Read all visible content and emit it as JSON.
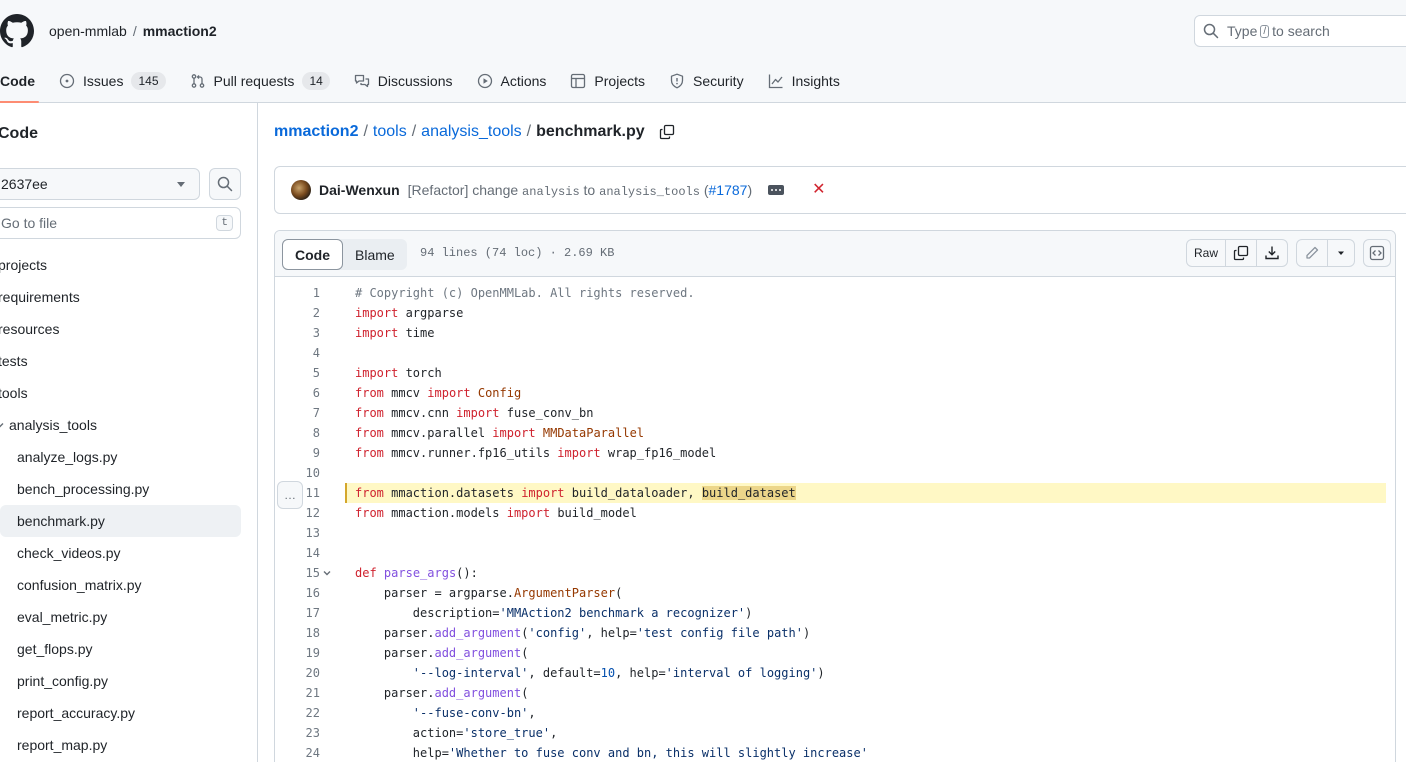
{
  "header": {
    "owner": "open-mmlab",
    "separator": "/",
    "repo": "mmaction2",
    "search_prefix": "Type",
    "search_key": "/",
    "search_suffix": "to search"
  },
  "tabs": [
    {
      "label": "Code",
      "icon": "code-icon",
      "selected": true
    },
    {
      "label": "Issues",
      "icon": "issue-opened-icon",
      "count": "145"
    },
    {
      "label": "Pull requests",
      "icon": "git-pull-request-icon",
      "count": "14"
    },
    {
      "label": "Discussions",
      "icon": "comment-discussion-icon"
    },
    {
      "label": "Actions",
      "icon": "play-icon"
    },
    {
      "label": "Projects",
      "icon": "table-icon"
    },
    {
      "label": "Security",
      "icon": "shield-icon"
    },
    {
      "label": "Insights",
      "icon": "graph-icon"
    }
  ],
  "sidebar": {
    "title": "Code",
    "branch": "2637ee",
    "goto_placeholder": "Go to file",
    "goto_shortcut": "t",
    "tree": [
      {
        "label": "projects",
        "depth": 0
      },
      {
        "label": "requirements",
        "depth": 0
      },
      {
        "label": "resources",
        "depth": 0
      },
      {
        "label": "tests",
        "depth": 0
      },
      {
        "label": "tools",
        "depth": 0
      },
      {
        "label": "analysis_tools",
        "depth": 1
      },
      {
        "label": "analyze_logs.py",
        "depth": 2
      },
      {
        "label": "bench_processing.py",
        "depth": 2
      },
      {
        "label": "benchmark.py",
        "depth": 2,
        "active": true
      },
      {
        "label": "check_videos.py",
        "depth": 2
      },
      {
        "label": "confusion_matrix.py",
        "depth": 2
      },
      {
        "label": "eval_metric.py",
        "depth": 2
      },
      {
        "label": "get_flops.py",
        "depth": 2
      },
      {
        "label": "print_config.py",
        "depth": 2
      },
      {
        "label": "report_accuracy.py",
        "depth": 2
      },
      {
        "label": "report_map.py",
        "depth": 2
      }
    ]
  },
  "breadcrumb": {
    "repo": "mmaction2",
    "dir1": "tools",
    "dir2": "analysis_tools",
    "file": "benchmark.py",
    "sep": "/"
  },
  "commit": {
    "author": "Dai-Wenxun",
    "msg_prefix": "[Refactor] change",
    "code_from": "analysis",
    "msg_mid": "to",
    "code_to": "analysis_tools",
    "pr_open": "(",
    "pr_link": "#1787",
    "pr_close": ")",
    "status_color": "#d1242f"
  },
  "file": {
    "tab_code": "Code",
    "tab_blame": "Blame",
    "meta": "94 lines (74 loc) · 2.69 KB",
    "raw_label": "Raw",
    "expand_label": "…"
  },
  "code_lines": [
    {
      "n": "1",
      "html": "<span class=\"cm\"># Copyright (c) OpenMMLab. All rights reserved.</span>"
    },
    {
      "n": "2",
      "html": "<span class=\"kw\">import</span> argparse"
    },
    {
      "n": "3",
      "html": "<span class=\"kw\">import</span> time"
    },
    {
      "n": "4",
      "html": ""
    },
    {
      "n": "5",
      "html": "<span class=\"kw\">import</span> torch"
    },
    {
      "n": "6",
      "html": "<span class=\"kw\">from</span> mmcv <span class=\"kw\">import</span> <span class=\"cls\">Config</span>"
    },
    {
      "n": "7",
      "html": "<span class=\"kw\">from</span> mmcv.cnn <span class=\"kw\">import</span> fuse_conv_bn"
    },
    {
      "n": "8",
      "html": "<span class=\"kw\">from</span> mmcv.parallel <span class=\"kw\">import</span> <span class=\"cls\">MMDataParallel</span>"
    },
    {
      "n": "9",
      "html": "<span class=\"kw\">from</span> mmcv.runner.fp16_utils <span class=\"kw\">import</span> wrap_fp16_model"
    },
    {
      "n": "10",
      "html": ""
    },
    {
      "n": "11",
      "html": "<span class=\"kw\">from</span> mmaction.datasets <span class=\"kw\">import</span> build_dataloader, <span class=\"mark\">build_dataset</span>",
      "highlight": true
    },
    {
      "n": "12",
      "html": "<span class=\"kw\">from</span> mmaction.models <span class=\"kw\">import</span> build_model"
    },
    {
      "n": "13",
      "html": ""
    },
    {
      "n": "14",
      "html": ""
    },
    {
      "n": "15",
      "html": "<span class=\"kw\">def</span> <span class=\"fn\">parse_args</span>():",
      "fold": true
    },
    {
      "n": "16",
      "html": "    parser = argparse.<span class=\"cls\">ArgumentParser</span>("
    },
    {
      "n": "17",
      "html": "        description=<span class=\"str\">'MMAction2 benchmark a recognizer'</span>)"
    },
    {
      "n": "18",
      "html": "    parser.<span class=\"fn\">add_argument</span>(<span class=\"str\">'config'</span>, help=<span class=\"str\">'test config file path'</span>)"
    },
    {
      "n": "19",
      "html": "    parser.<span class=\"fn\">add_argument</span>("
    },
    {
      "n": "20",
      "html": "        <span class=\"str\">'--log-interval'</span>, default=<span class=\"num\">10</span>, help=<span class=\"str\">'interval of logging'</span>)"
    },
    {
      "n": "21",
      "html": "    parser.<span class=\"fn\">add_argument</span>("
    },
    {
      "n": "22",
      "html": "        <span class=\"str\">'--fuse-conv-bn'</span>,"
    },
    {
      "n": "23",
      "html": "        action=<span class=\"str\">'store_true'</span>,"
    },
    {
      "n": "24",
      "html": "        help=<span class=\"str\">'Whether to fuse conv and bn, this will slightly increase'</span>"
    }
  ]
}
